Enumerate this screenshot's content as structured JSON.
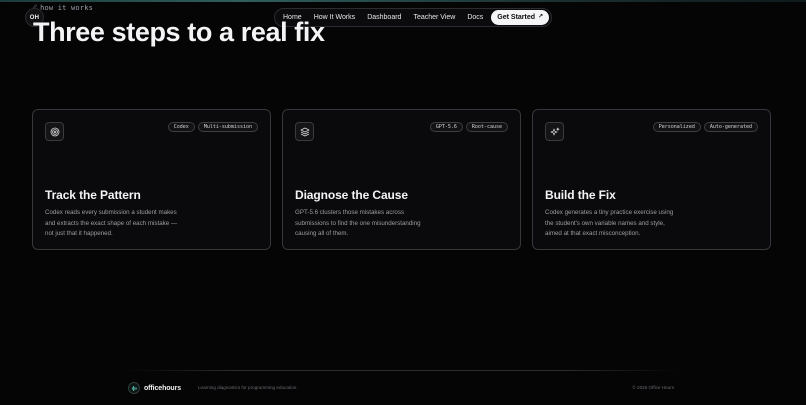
{
  "eyebrow": {
    "text": "how it works"
  },
  "brand": {
    "badge": "OH"
  },
  "nav": {
    "links": [
      "Home",
      "How It Works",
      "Dashboard",
      "Teacher View",
      "Docs"
    ],
    "cta": "Get Started",
    "cta_icon": "arrow-up-right-icon"
  },
  "hero": {
    "title": "Three steps to a real fix"
  },
  "cards": [
    {
      "icon": "target-icon",
      "tags": [
        "Codex",
        "Multi-submission"
      ],
      "title": "Track the Pattern",
      "description": "Codex reads every submission a student makes and extracts the exact shape of each mistake — not just that it happened."
    },
    {
      "icon": "layers-icon",
      "tags": [
        "GPT-5.6",
        "Root-cause"
      ],
      "title": "Diagnose the Cause",
      "description": "GPT-5.6 clusters those mistakes across submissions to find the one misunderstanding causing all of them."
    },
    {
      "icon": "sparkles-icon",
      "tags": [
        "Personalized",
        "Auto-generated"
      ],
      "title": "Build the Fix",
      "description": "Codex generates a tiny practice exercise using the student's own variable names and style, aimed at that exact misconception."
    }
  ],
  "footer": {
    "brand_name": "officehours",
    "tagline": "Learning diagnostics for programming education.",
    "copyright": "© 2026 Office Hours"
  },
  "colors": {
    "background": "#050506",
    "accent": "#5fd3c0",
    "card_border": "#36363b"
  }
}
